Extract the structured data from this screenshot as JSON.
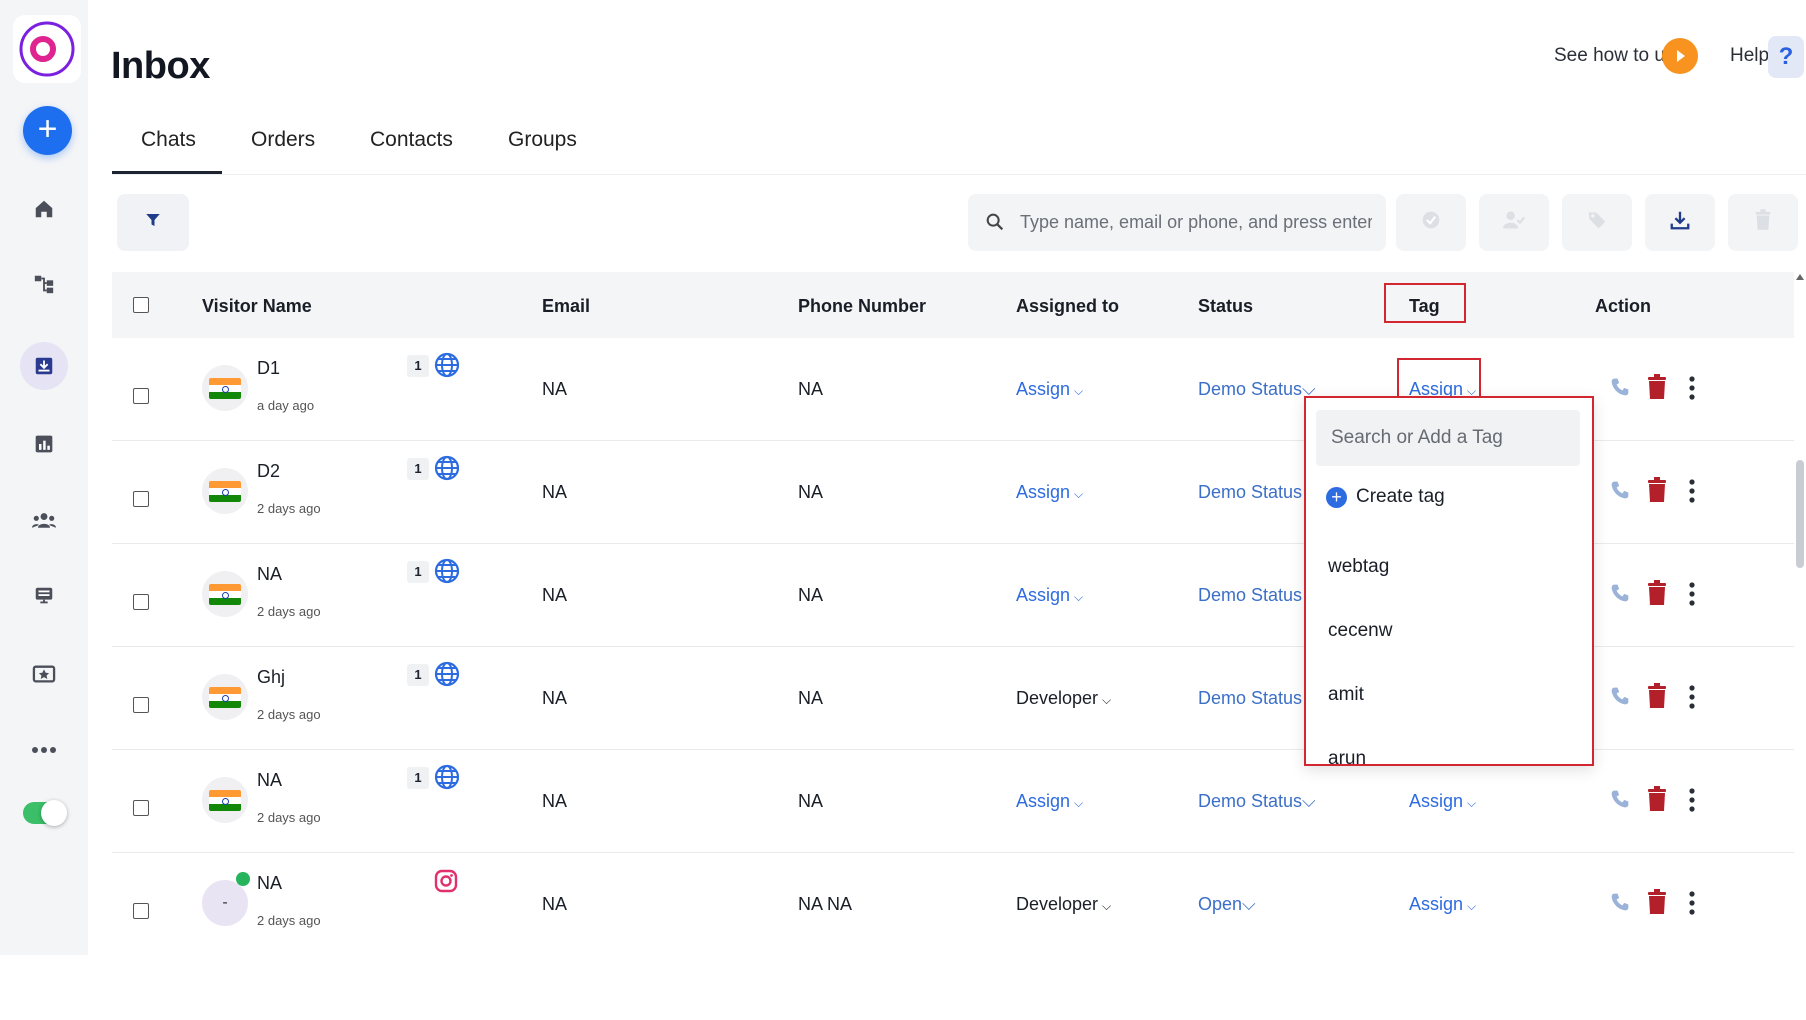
{
  "header": {
    "title": "Inbox",
    "see_how_label": "See how to use",
    "help_label": "Help",
    "help_glyph": "?"
  },
  "tabs": [
    {
      "label": "Chats",
      "active": true
    },
    {
      "label": "Orders",
      "active": false
    },
    {
      "label": "Contacts",
      "active": false
    },
    {
      "label": "Groups",
      "active": false
    }
  ],
  "search": {
    "placeholder": "Type name, email or phone, and press enter"
  },
  "table": {
    "columns": [
      "Visitor Name",
      "Email",
      "Phone Number",
      "Assigned to",
      "Status",
      "Tag",
      "Action"
    ],
    "rows": [
      {
        "name": "D1",
        "time": "a day ago",
        "count": "1",
        "channel": "globe-icon",
        "email": "NA",
        "phone": "NA",
        "assigned": "Assign",
        "status": "Demo Status",
        "tag": "Assign"
      },
      {
        "name": "D2",
        "time": "2 days ago",
        "count": "1",
        "channel": "globe-icon",
        "email": "NA",
        "phone": "NA",
        "assigned": "Assign",
        "status": "Demo Status",
        "tag": ""
      },
      {
        "name": "NA",
        "time": "2 days ago",
        "count": "1",
        "channel": "globe-icon",
        "email": "NA",
        "phone": "NA",
        "assigned": "Assign",
        "status": "Demo Status",
        "tag": ""
      },
      {
        "name": "Ghj",
        "time": "2 days ago",
        "count": "1",
        "channel": "globe-icon",
        "email": "NA",
        "phone": "NA",
        "assigned": "Developer",
        "status": "Demo Status",
        "tag": ""
      },
      {
        "name": "NA",
        "time": "2 days ago",
        "count": "1",
        "channel": "globe-icon",
        "email": "NA",
        "phone": "NA",
        "assigned": "Assign",
        "status": "Demo Status",
        "tag": "Assign"
      },
      {
        "name": "NA",
        "time": "2 days ago",
        "count": "",
        "channel": "instagram-icon",
        "avatar_text": "-",
        "email": "NA",
        "phone": "NA NA",
        "assigned": "Developer",
        "status": "Open",
        "tag": "Assign"
      }
    ]
  },
  "tag_dropdown": {
    "search_placeholder": "Search or Add a Tag",
    "create_label": "Create tag",
    "items": [
      "webtag",
      "cecenw",
      "amit",
      "arun"
    ]
  },
  "colors": {
    "accent": "#1e6ff0",
    "link": "#2d6be0",
    "highlight": "#d22630",
    "trash": "#b3202a",
    "play": "#f7931e",
    "toggle_on": "#3bbf69"
  }
}
